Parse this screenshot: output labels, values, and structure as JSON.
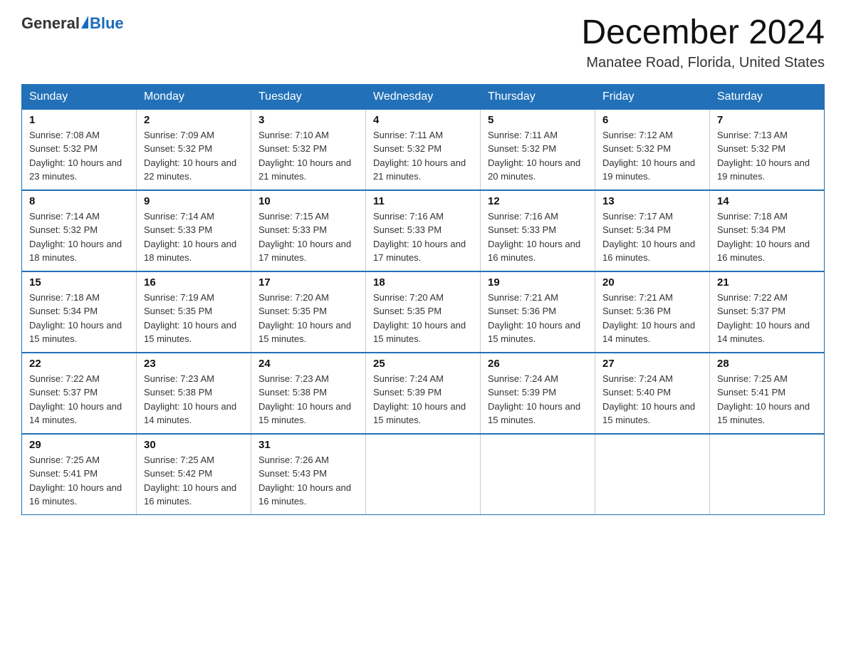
{
  "header": {
    "logo_general": "General",
    "logo_blue": "Blue",
    "month_title": "December 2024",
    "location": "Manatee Road, Florida, United States"
  },
  "weekdays": [
    "Sunday",
    "Monday",
    "Tuesday",
    "Wednesday",
    "Thursday",
    "Friday",
    "Saturday"
  ],
  "weeks": [
    [
      {
        "day": "1",
        "sunrise": "7:08 AM",
        "sunset": "5:32 PM",
        "daylight": "10 hours and 23 minutes."
      },
      {
        "day": "2",
        "sunrise": "7:09 AM",
        "sunset": "5:32 PM",
        "daylight": "10 hours and 22 minutes."
      },
      {
        "day": "3",
        "sunrise": "7:10 AM",
        "sunset": "5:32 PM",
        "daylight": "10 hours and 21 minutes."
      },
      {
        "day": "4",
        "sunrise": "7:11 AM",
        "sunset": "5:32 PM",
        "daylight": "10 hours and 21 minutes."
      },
      {
        "day": "5",
        "sunrise": "7:11 AM",
        "sunset": "5:32 PM",
        "daylight": "10 hours and 20 minutes."
      },
      {
        "day": "6",
        "sunrise": "7:12 AM",
        "sunset": "5:32 PM",
        "daylight": "10 hours and 19 minutes."
      },
      {
        "day": "7",
        "sunrise": "7:13 AM",
        "sunset": "5:32 PM",
        "daylight": "10 hours and 19 minutes."
      }
    ],
    [
      {
        "day": "8",
        "sunrise": "7:14 AM",
        "sunset": "5:32 PM",
        "daylight": "10 hours and 18 minutes."
      },
      {
        "day": "9",
        "sunrise": "7:14 AM",
        "sunset": "5:33 PM",
        "daylight": "10 hours and 18 minutes."
      },
      {
        "day": "10",
        "sunrise": "7:15 AM",
        "sunset": "5:33 PM",
        "daylight": "10 hours and 17 minutes."
      },
      {
        "day": "11",
        "sunrise": "7:16 AM",
        "sunset": "5:33 PM",
        "daylight": "10 hours and 17 minutes."
      },
      {
        "day": "12",
        "sunrise": "7:16 AM",
        "sunset": "5:33 PM",
        "daylight": "10 hours and 16 minutes."
      },
      {
        "day": "13",
        "sunrise": "7:17 AM",
        "sunset": "5:34 PM",
        "daylight": "10 hours and 16 minutes."
      },
      {
        "day": "14",
        "sunrise": "7:18 AM",
        "sunset": "5:34 PM",
        "daylight": "10 hours and 16 minutes."
      }
    ],
    [
      {
        "day": "15",
        "sunrise": "7:18 AM",
        "sunset": "5:34 PM",
        "daylight": "10 hours and 15 minutes."
      },
      {
        "day": "16",
        "sunrise": "7:19 AM",
        "sunset": "5:35 PM",
        "daylight": "10 hours and 15 minutes."
      },
      {
        "day": "17",
        "sunrise": "7:20 AM",
        "sunset": "5:35 PM",
        "daylight": "10 hours and 15 minutes."
      },
      {
        "day": "18",
        "sunrise": "7:20 AM",
        "sunset": "5:35 PM",
        "daylight": "10 hours and 15 minutes."
      },
      {
        "day": "19",
        "sunrise": "7:21 AM",
        "sunset": "5:36 PM",
        "daylight": "10 hours and 15 minutes."
      },
      {
        "day": "20",
        "sunrise": "7:21 AM",
        "sunset": "5:36 PM",
        "daylight": "10 hours and 14 minutes."
      },
      {
        "day": "21",
        "sunrise": "7:22 AM",
        "sunset": "5:37 PM",
        "daylight": "10 hours and 14 minutes."
      }
    ],
    [
      {
        "day": "22",
        "sunrise": "7:22 AM",
        "sunset": "5:37 PM",
        "daylight": "10 hours and 14 minutes."
      },
      {
        "day": "23",
        "sunrise": "7:23 AM",
        "sunset": "5:38 PM",
        "daylight": "10 hours and 14 minutes."
      },
      {
        "day": "24",
        "sunrise": "7:23 AM",
        "sunset": "5:38 PM",
        "daylight": "10 hours and 15 minutes."
      },
      {
        "day": "25",
        "sunrise": "7:24 AM",
        "sunset": "5:39 PM",
        "daylight": "10 hours and 15 minutes."
      },
      {
        "day": "26",
        "sunrise": "7:24 AM",
        "sunset": "5:39 PM",
        "daylight": "10 hours and 15 minutes."
      },
      {
        "day": "27",
        "sunrise": "7:24 AM",
        "sunset": "5:40 PM",
        "daylight": "10 hours and 15 minutes."
      },
      {
        "day": "28",
        "sunrise": "7:25 AM",
        "sunset": "5:41 PM",
        "daylight": "10 hours and 15 minutes."
      }
    ],
    [
      {
        "day": "29",
        "sunrise": "7:25 AM",
        "sunset": "5:41 PM",
        "daylight": "10 hours and 16 minutes."
      },
      {
        "day": "30",
        "sunrise": "7:25 AM",
        "sunset": "5:42 PM",
        "daylight": "10 hours and 16 minutes."
      },
      {
        "day": "31",
        "sunrise": "7:26 AM",
        "sunset": "5:43 PM",
        "daylight": "10 hours and 16 minutes."
      },
      null,
      null,
      null,
      null
    ]
  ]
}
